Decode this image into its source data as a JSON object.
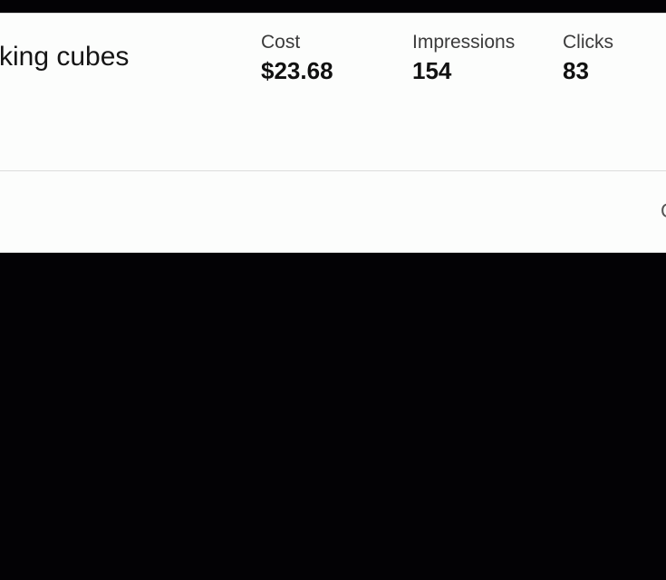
{
  "campaign": {
    "name": "cking cubes"
  },
  "metrics": [
    {
      "label": "Cost",
      "value": "$23.68"
    },
    {
      "label": "Impressions",
      "value": "154"
    },
    {
      "label": "Clicks",
      "value": "83"
    }
  ],
  "footer": {
    "edge_text": "C"
  }
}
